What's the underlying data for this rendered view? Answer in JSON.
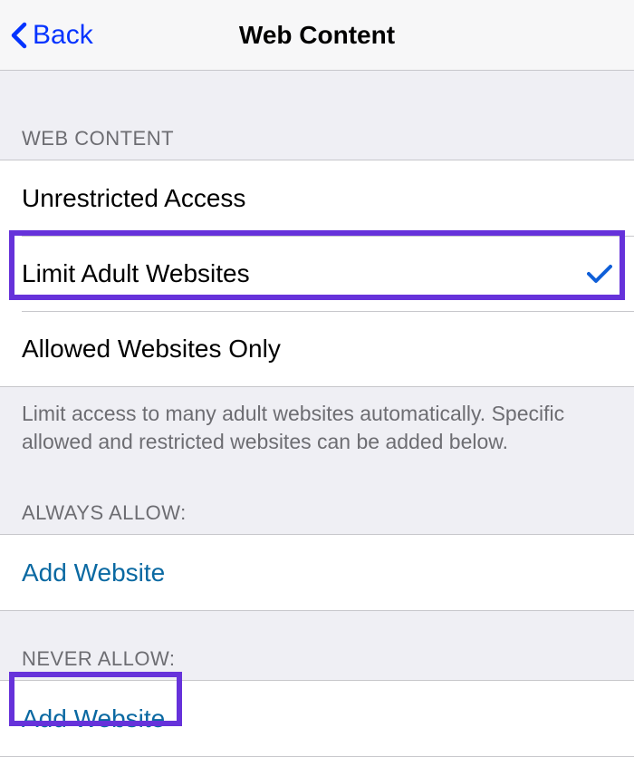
{
  "nav": {
    "back": "Back",
    "title": "Web Content"
  },
  "sections": {
    "webContent": {
      "header": "WEB CONTENT",
      "options": {
        "unrestricted": "Unrestricted Access",
        "limitAdult": "Limit Adult Websites",
        "allowedOnly": "Allowed Websites Only"
      },
      "footer": "Limit access to many adult websites automatically. Specific allowed and restricted websites can be added below."
    },
    "alwaysAllow": {
      "header": "ALWAYS ALLOW:",
      "addWebsite": "Add Website"
    },
    "neverAllow": {
      "header": "NEVER ALLOW:",
      "addWebsite": "Add Website"
    }
  }
}
